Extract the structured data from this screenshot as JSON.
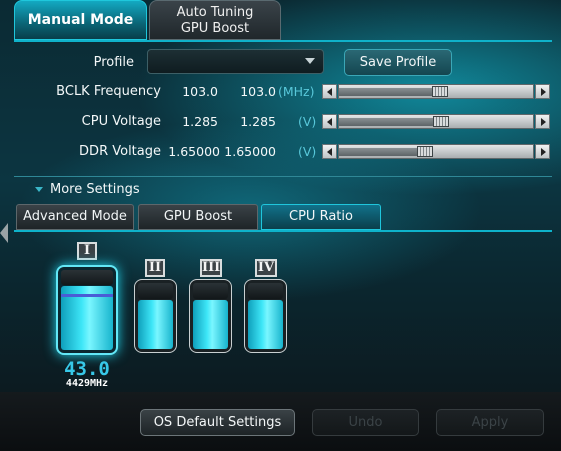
{
  "top_tabs": [
    {
      "label": "Manual Mode"
    },
    {
      "label_line1": "Auto Tuning",
      "label_line2": "GPU Boost"
    }
  ],
  "profile": {
    "label": "Profile",
    "selected": "",
    "save_label": "Save Profile"
  },
  "settings": [
    {
      "label": "BCLK Frequency",
      "current": "103.0",
      "target": "103.0",
      "unit": "(MHz)",
      "slider_fraction": 0.52
    },
    {
      "label": "CPU Voltage",
      "current": "1.285",
      "target": "1.285",
      "unit": "(V)",
      "slider_fraction": 0.53
    },
    {
      "label": "DDR Voltage",
      "current": "1.65000",
      "target": "1.65000",
      "unit": "(V)",
      "slider_fraction": 0.44
    }
  ],
  "more_settings": {
    "label": "More Settings"
  },
  "sub_tabs": [
    {
      "label": "Advanced Mode"
    },
    {
      "label": "GPU Boost"
    },
    {
      "label": "CPU Ratio"
    }
  ],
  "cores": [
    {
      "label": "I",
      "selected": true,
      "fill_fraction": 0.8
    },
    {
      "label": "II",
      "selected": false,
      "fill_fraction": 0.74
    },
    {
      "label": "III",
      "selected": false,
      "fill_fraction": 0.74
    },
    {
      "label": "IV",
      "selected": false,
      "fill_fraction": 0.74
    }
  ],
  "selected_core": {
    "ratio": "43.0",
    "frequency": "4429MHz"
  },
  "bottom_buttons": {
    "os_default": "OS Default Settings",
    "undo": "Undo",
    "apply": "Apply"
  },
  "colors": {
    "accent": "#1fc7dc",
    "value_blue": "#37c8e8"
  }
}
